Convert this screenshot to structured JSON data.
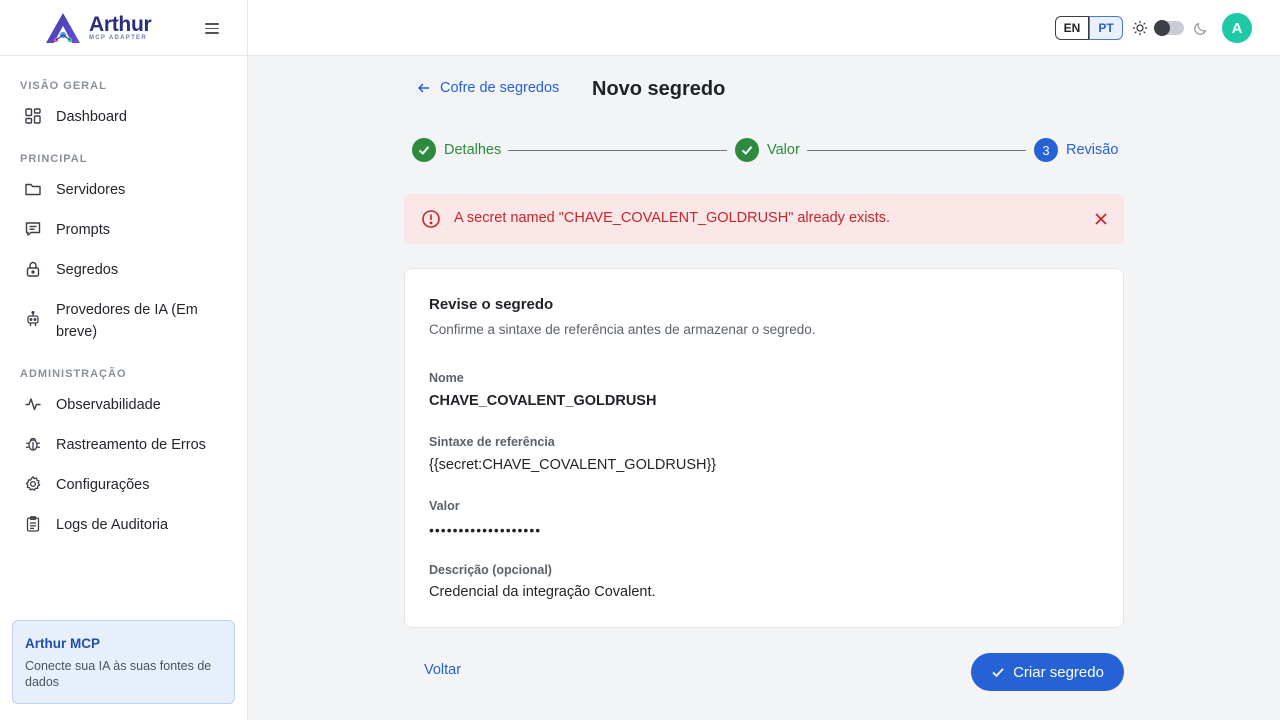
{
  "brand": {
    "name": "Arthur",
    "subtitle": "MCP ADAPTER"
  },
  "sidebar": {
    "sections": [
      {
        "label": "VISÃO GERAL",
        "items": [
          {
            "label": "Dashboard",
            "icon": "dashboard-icon"
          }
        ]
      },
      {
        "label": "PRINCIPAL",
        "items": [
          {
            "label": "Servidores",
            "icon": "folder-icon"
          },
          {
            "label": "Prompts",
            "icon": "message-icon"
          },
          {
            "label": "Segredos",
            "icon": "lock-icon"
          },
          {
            "label": "Provedores de IA (Em breve)",
            "icon": "robot-icon"
          }
        ]
      },
      {
        "label": "ADMINISTRAÇÃO",
        "items": [
          {
            "label": "Observabilidade",
            "icon": "activity-icon"
          },
          {
            "label": "Rastreamento de Erros",
            "icon": "bug-icon"
          },
          {
            "label": "Configurações",
            "icon": "gear-icon"
          },
          {
            "label": "Logs de Auditoria",
            "icon": "clipboard-icon"
          }
        ]
      }
    ],
    "promo": {
      "title": "Arthur MCP",
      "text": "Conecte sua IA às suas fontes de dados"
    }
  },
  "topbar": {
    "lang_en": "EN",
    "lang_pt": "PT",
    "selected_lang": "PT",
    "dark_mode": false,
    "avatar_initial": "A",
    "avatar_color": "#1ec9a6"
  },
  "header": {
    "back_label": "Cofre de segredos",
    "title": "Novo segredo"
  },
  "stepper": {
    "steps": [
      {
        "label": "Detalhes",
        "status": "done"
      },
      {
        "label": "Valor",
        "status": "done"
      },
      {
        "label": "Revisão",
        "status": "active",
        "number": "3"
      }
    ]
  },
  "alert": {
    "message": "A secret named \"CHAVE_COVALENT_GOLDRUSH\" already exists.",
    "color": "#c6262a"
  },
  "review": {
    "title": "Revise o segredo",
    "subtitle": "Confirme a sintaxe de referência antes de armazenar o segredo.",
    "name_label": "Nome",
    "name_value": "CHAVE_COVALENT_GOLDRUSH",
    "syntax_label": "Sintaxe de referência",
    "syntax_value": "{{secret:CHAVE_COVALENT_GOLDRUSH}}",
    "value_label": "Valor",
    "value_masked": "•••••••••••••••••••",
    "description_label": "Descrição (opcional)",
    "description_value": "Credencial da integração Covalent."
  },
  "actions": {
    "back_label": "Voltar",
    "create_label": "Criar segredo"
  },
  "colors": {
    "primary": "#2462d6",
    "success": "#2e8b3e",
    "danger": "#c6262a"
  }
}
